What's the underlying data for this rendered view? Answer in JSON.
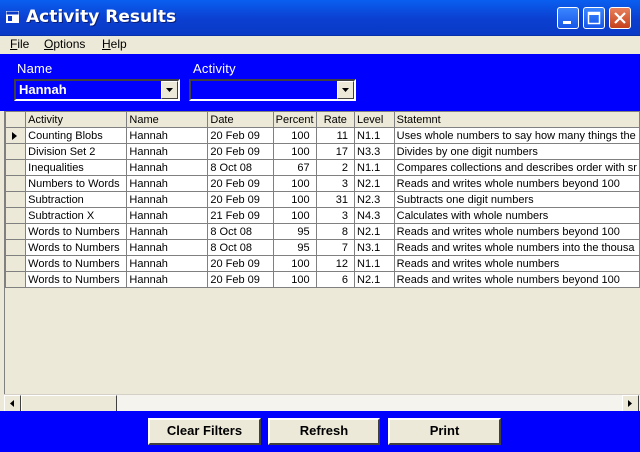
{
  "window": {
    "title": "Activity Results",
    "icon": "app-window-icon",
    "controls": [
      "minimize-icon",
      "maximize-icon",
      "close-icon"
    ]
  },
  "menu": [
    {
      "label": "File",
      "accel": "F",
      "rest": "ile"
    },
    {
      "label": "Options",
      "accel": "O",
      "rest": "ptions"
    },
    {
      "label": "Help",
      "accel": "H",
      "rest": "elp"
    }
  ],
  "filters": {
    "name_label": "Name",
    "name_value": "Hannah",
    "activity_label": "Activity",
    "activity_value": ""
  },
  "grid": {
    "columns": [
      "Activity",
      "Name",
      "Date",
      "Percent",
      "Rate",
      "Level",
      "Statemnt"
    ],
    "selected_row": 0,
    "rows": [
      [
        "Counting Blobs",
        "Hannah",
        "20 Feb 09",
        "100",
        "11",
        "N1.1",
        "Uses whole numbers to say how many things the"
      ],
      [
        "Division Set 2",
        "Hannah",
        "20 Feb 09",
        "100",
        "17",
        "N3.3",
        "Divides by one digit numbers"
      ],
      [
        "Inequalities",
        "Hannah",
        "8 Oct 08",
        "67",
        "2",
        "N1.1",
        "Compares collections and describes order with sr"
      ],
      [
        "Numbers to Words",
        "Hannah",
        "20 Feb 09",
        "100",
        "3",
        "N2.1",
        "Reads and writes whole numbers beyond 100"
      ],
      [
        "Subtraction",
        "Hannah",
        "20 Feb 09",
        "100",
        "31",
        "N2.3",
        "Subtracts one digit numbers"
      ],
      [
        "Subtraction X",
        "Hannah",
        "21 Feb 09",
        "100",
        "3",
        "N4.3",
        "Calculates with whole numbers"
      ],
      [
        "Words to Numbers",
        "Hannah",
        "8 Oct 08",
        "95",
        "8",
        "N2.1",
        "Reads and writes whole numbers beyond 100"
      ],
      [
        "Words to Numbers",
        "Hannah",
        "8 Oct 08",
        "95",
        "7",
        "N3.1",
        "Reads and writes whole numbers into the thousa"
      ],
      [
        "Words to Numbers",
        "Hannah",
        "20 Feb 09",
        "100",
        "12",
        "N1.1",
        "Reads and writes whole numbers"
      ],
      [
        "Words to Numbers",
        "Hannah",
        "20 Feb 09",
        "100",
        "6",
        "N2.1",
        "Reads and writes whole numbers beyond 100"
      ]
    ]
  },
  "buttons": {
    "clear_filters": "Clear Filters",
    "refresh": "Refresh",
    "print": "Print"
  },
  "colors": {
    "panel_blue": "#0000ff",
    "titlebar_blue": "#0b3fd0",
    "face": "#ece9d8"
  }
}
